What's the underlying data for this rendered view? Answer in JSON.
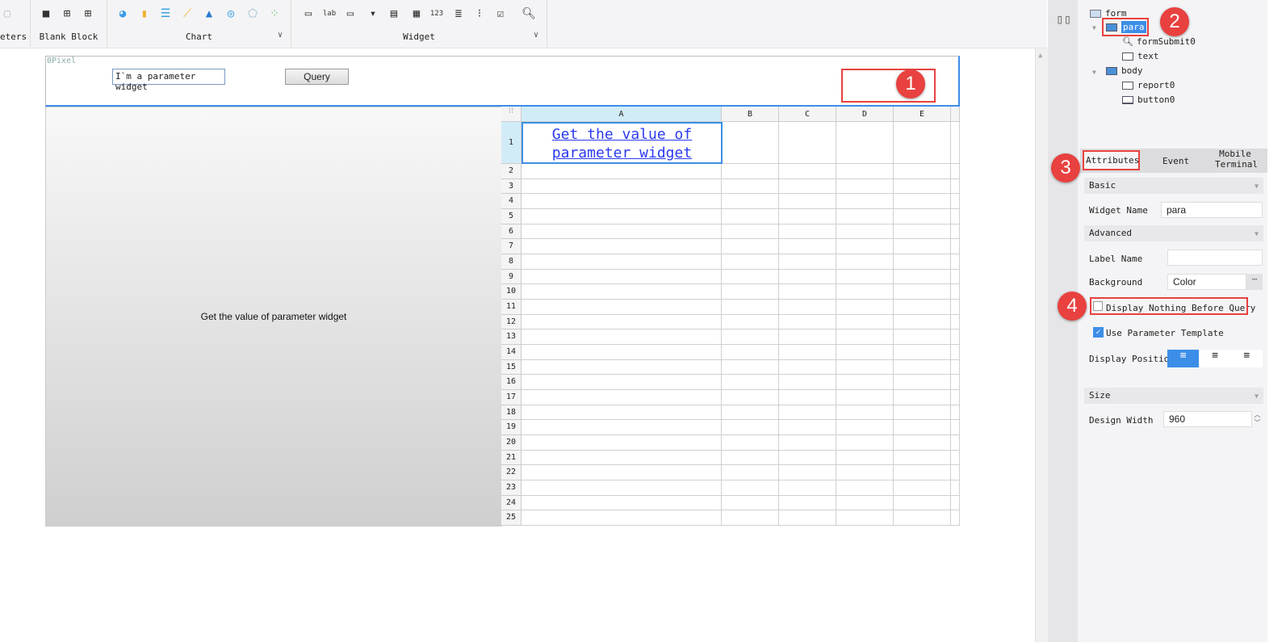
{
  "toolbar": {
    "groups": [
      {
        "label": "eters"
      },
      {
        "label": "Blank Block"
      },
      {
        "label": "Chart"
      },
      {
        "label": "Widget"
      }
    ]
  },
  "param_pane": {
    "corner_label": "0Pixel",
    "widget_text": "I`m a parameter widget",
    "query_button": "Query"
  },
  "body": {
    "left_block_text": "Get the value of parameter widget"
  },
  "sheet": {
    "columns": [
      "A",
      "B",
      "C",
      "D",
      "E"
    ],
    "rows": [
      "1",
      "2",
      "3",
      "4",
      "5",
      "6",
      "7",
      "8",
      "9",
      "10",
      "11",
      "12",
      "13",
      "14",
      "15",
      "16",
      "17",
      "18",
      "19",
      "20",
      "21",
      "22",
      "23",
      "24",
      "25"
    ],
    "cell_a1_line1": "Get the value of",
    "cell_a1_line2": "parameter widget"
  },
  "tree": {
    "items": [
      {
        "label": "form"
      },
      {
        "label": "para"
      },
      {
        "label": "formSubmit0"
      },
      {
        "label": "text"
      },
      {
        "label": "body"
      },
      {
        "label": "report0"
      },
      {
        "label": "button0"
      }
    ]
  },
  "tabs": {
    "attributes": "Attributes",
    "event": "Event",
    "mobile": "Mobile Terminal"
  },
  "props": {
    "basic": "Basic",
    "widget_name_label": "Widget Name",
    "widget_name_value": "para",
    "advanced": "Advanced",
    "label_name_label": "Label Name",
    "label_name_value": "",
    "background_label": "Background",
    "background_value": "Color",
    "display_nothing": "Display Nothing Before Query",
    "display_nothing_checked": false,
    "use_template": "Use Parameter Template",
    "use_template_checked": true,
    "display_position": "Display Position",
    "size": "Size",
    "design_width_label": "Design Width",
    "design_width_value": "960"
  },
  "annotations": [
    "1",
    "2",
    "3",
    "4"
  ],
  "colors": {
    "accent": "#3d8ee8",
    "annotation": "#e8413f"
  }
}
